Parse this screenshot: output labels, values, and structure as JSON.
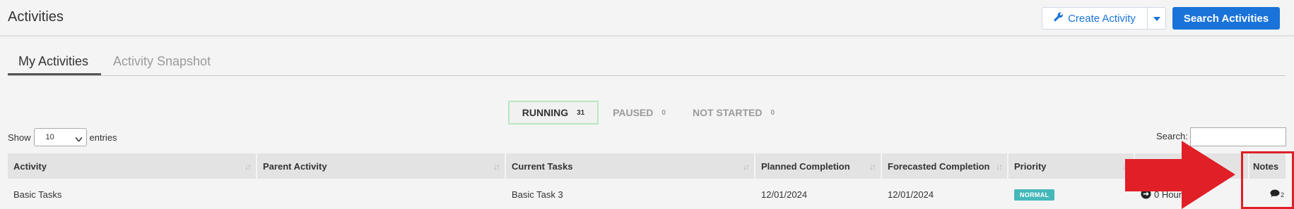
{
  "header": {
    "title": "Activities",
    "create_button": "Create Activity",
    "search_button": "Search Activities"
  },
  "tabs": [
    {
      "label": "My Activities",
      "active": true
    },
    {
      "label": "Activity Snapshot",
      "active": false
    }
  ],
  "status_tabs": [
    {
      "label": "RUNNING",
      "count": "31"
    },
    {
      "label": "PAUSED",
      "count": "0"
    },
    {
      "label": "NOT STARTED",
      "count": "0"
    }
  ],
  "table_controls": {
    "show_label": "Show",
    "page_size": "10",
    "entries_label": "entries",
    "search_label": "Search:"
  },
  "table": {
    "columns": [
      "Activity",
      "Parent Activity",
      "Current Tasks",
      "Planned Completion",
      "Forecasted Completion",
      "Priority",
      "Notes"
    ],
    "rows": [
      {
        "activity": "Basic Tasks",
        "parent_activity": "",
        "current_tasks": "Basic Task 3",
        "planned_completion": "12/01/2024",
        "forecasted_completion": "12/01/2024",
        "priority": "NORMAL",
        "time": "0 Hour",
        "notes_count": "2"
      }
    ]
  },
  "colors": {
    "primary": "#1a73d9",
    "badge": "#45b8ba",
    "annotation": "#e01f26"
  },
  "icons": [
    "wrench-icon",
    "caret-down-icon",
    "sort-icon",
    "arrow-circle-icon",
    "comment-icon"
  ]
}
